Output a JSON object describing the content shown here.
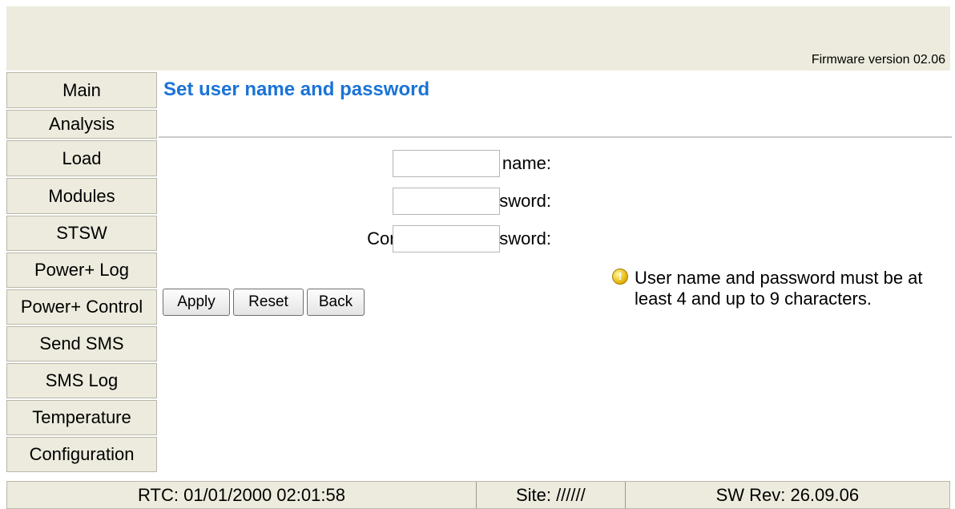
{
  "header": {
    "firmware": "Firmware version 02.06"
  },
  "sidebar": {
    "items": [
      {
        "label": "Main"
      },
      {
        "label": "Analysis"
      },
      {
        "label": "Load"
      },
      {
        "label": "Modules"
      },
      {
        "label": "STSW"
      },
      {
        "label": "Power+ Log"
      },
      {
        "label": "Power+ Control"
      },
      {
        "label": "Send SMS"
      },
      {
        "label": "SMS Log"
      },
      {
        "label": "Temperature"
      },
      {
        "label": "Configuration"
      }
    ]
  },
  "main": {
    "title": "Set user name and password",
    "form": {
      "username_label": "New user name:",
      "username_value": "",
      "password_label": "New password:",
      "password_value": "",
      "confirm_label": "Confirm new password:",
      "confirm_value": ""
    },
    "buttons": {
      "apply": "Apply",
      "reset": "Reset",
      "back": "Back"
    },
    "info": {
      "icon": "warning-icon",
      "text": "User name and password must be at least 4 and up to 9 characters."
    }
  },
  "footer": {
    "rtc": "RTC: 01/01/2000 02:01:58",
    "site": "Site: //////",
    "sw_rev": "SW Rev: 26.09.06"
  },
  "colors": {
    "panel_bg": "#ecebdd",
    "title": "#1a73d6"
  }
}
